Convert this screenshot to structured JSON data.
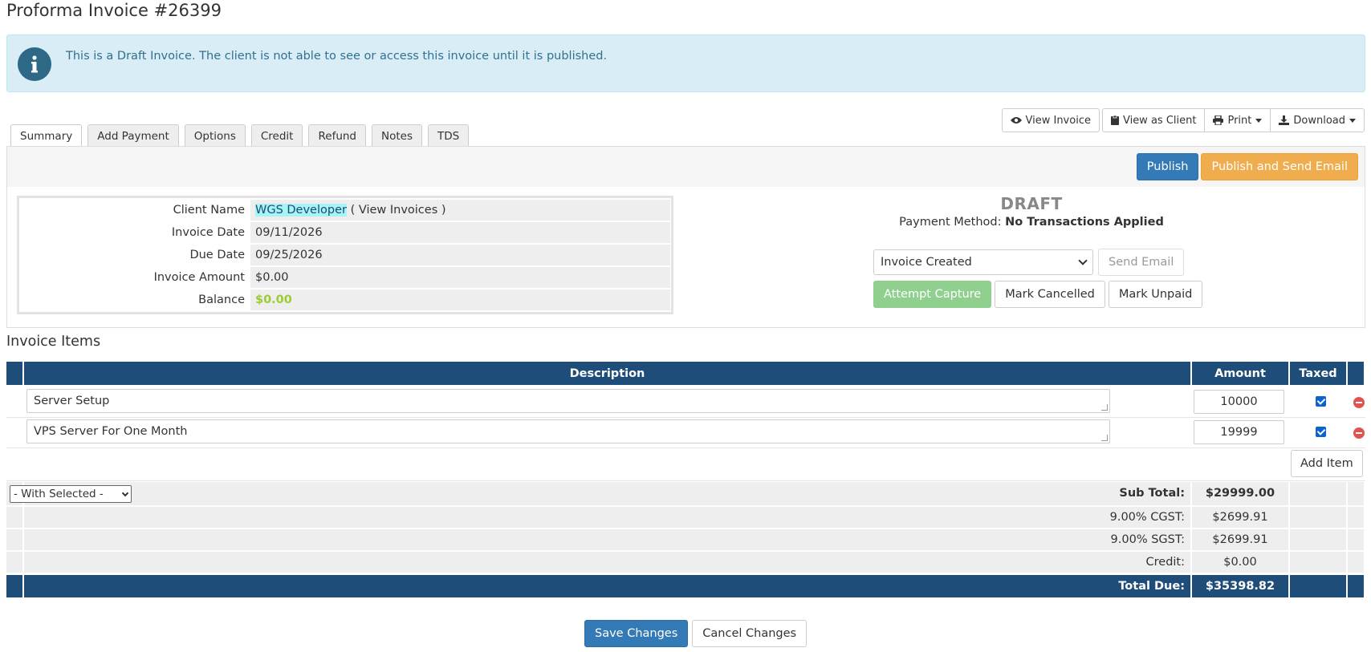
{
  "page": {
    "title": "Proforma Invoice #26399"
  },
  "alert": {
    "icon": "info-icon",
    "text": "This is a Draft Invoice. The client is not able to see or access this invoice until it is published."
  },
  "top_actions": {
    "view_invoice": "View Invoice",
    "view_as_client": "View as Client",
    "print": "Print",
    "download": "Download"
  },
  "tabs": [
    "Summary",
    "Add Payment",
    "Options",
    "Credit",
    "Refund",
    "Notes",
    "TDS"
  ],
  "publish": {
    "publish_label": "Publish",
    "publish_send_label": "Publish and Send Email"
  },
  "client": {
    "labels": {
      "name": "Client Name",
      "invoice_date": "Invoice Date",
      "due_date": "Due Date",
      "amount": "Invoice Amount",
      "balance": "Balance"
    },
    "name": "WGS Developer",
    "view_invoices": "( View Invoices )",
    "invoice_date": "09/11/2026",
    "due_date": "09/25/2026",
    "amount": "$0.00",
    "balance": "$0.00"
  },
  "status": {
    "label": "DRAFT",
    "payment_method_label": "Payment Method:",
    "payment_method_value": "No Transactions Applied",
    "email_template": "Invoice Created",
    "send_email": "Send Email",
    "attempt_capture": "Attempt Capture",
    "mark_cancelled": "Mark Cancelled",
    "mark_unpaid": "Mark Unpaid"
  },
  "items_section": {
    "title": "Invoice Items",
    "headers": {
      "description": "Description",
      "amount": "Amount",
      "taxed": "Taxed"
    },
    "items": [
      {
        "description": "Server Setup",
        "amount": "10000",
        "taxed": true
      },
      {
        "description": "VPS Server For One Month",
        "amount": "19999",
        "taxed": true
      }
    ],
    "add_item": "Add Item",
    "with_selected": "- With Selected -"
  },
  "totals": {
    "subtotal_label": "Sub Total:",
    "subtotal": "$29999.00",
    "cgst_label": "9.00% CGST:",
    "cgst": "$2699.91",
    "sgst_label": "9.00% SGST:",
    "sgst": "$2699.91",
    "credit_label": "Credit:",
    "credit": "$0.00",
    "total_label": "Total Due:",
    "total": "$35398.82"
  },
  "footer": {
    "save": "Save Changes",
    "cancel": "Cancel Changes"
  },
  "colors": {
    "header_blue": "#1f4d7a",
    "primary": "#337ab7",
    "warning": "#f0ad4e",
    "alert_bg": "#d9edf7"
  }
}
